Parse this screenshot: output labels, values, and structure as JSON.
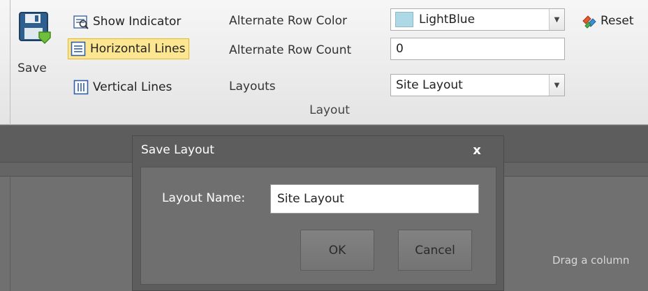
{
  "ribbon": {
    "save_label": "Save",
    "show_indicator": "Show Indicator",
    "horizontal_lines": "Horizontal Lines",
    "vertical_lines": "Vertical Lines",
    "alternate_row_color_label": "Alternate Row Color",
    "alternate_row_color_value": "LightBlue",
    "alternate_row_count_label": "Alternate Row Count",
    "alternate_row_count_value": "0",
    "layouts_label": "Layouts",
    "layouts_value": "Site Layout",
    "reset_label": "Reset",
    "group_caption": "Layout",
    "swatch_color": "#add8e6"
  },
  "grid": {
    "drag_hint": "Drag a column"
  },
  "dialog": {
    "title": "Save Layout",
    "close": "x",
    "name_label": "Layout Name:",
    "name_value": "Site Layout",
    "ok_label": "OK",
    "cancel_label": "Cancel"
  },
  "icons": {
    "save": "save-floppy-icon",
    "show_indicator": "indicator-icon",
    "horizontal_lines": "horizontal-lines-icon",
    "vertical_lines": "vertical-lines-icon",
    "reset": "reset-icon",
    "dropdown": "chevron-down-icon"
  }
}
